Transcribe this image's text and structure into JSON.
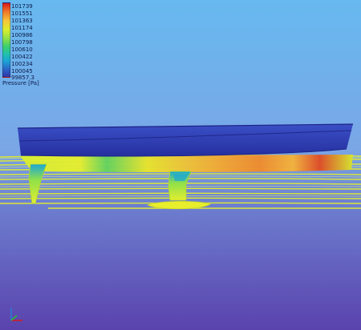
{
  "legend": {
    "title": "Pressure [Pa]",
    "tick_labels": [
      "101739",
      "101551",
      "101363",
      "101174",
      "100986",
      "100798",
      "100610",
      "100422",
      "100234",
      "100045",
      "99857.3"
    ],
    "color_stops": [
      "#d7191c",
      "#f07a2a",
      "#f6c63a",
      "#d9ee2e",
      "#8fe04a",
      "#3fd06b",
      "#22c3a6",
      "#1aa7d6",
      "#2a68c9",
      "#2e35a7"
    ]
  },
  "scene": {
    "background_top": "#66b7ee",
    "background_mid": "#7a9ee0",
    "background_bottom": "#5b46b0",
    "hull_color": "#2f3fb4",
    "streamline_color": "#e4ee2a"
  }
}
